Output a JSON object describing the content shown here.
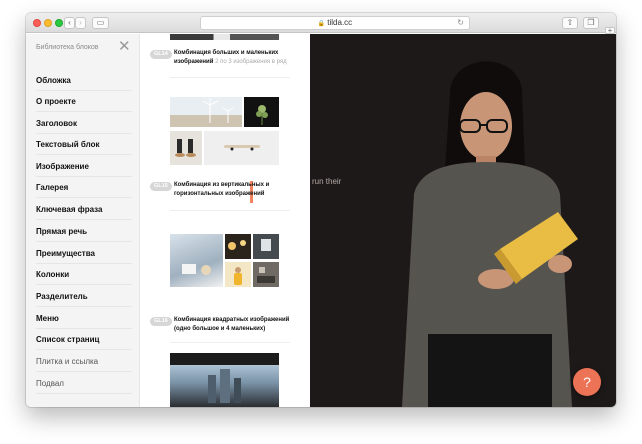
{
  "browser": {
    "url": "tilda.cc"
  },
  "sidebar": {
    "title": "Библиотека блоков",
    "items": [
      {
        "label": "Обложка"
      },
      {
        "label": "О проекте"
      },
      {
        "label": "Заголовок"
      },
      {
        "label": "Текстовый блок"
      },
      {
        "label": "Изображение"
      },
      {
        "label": "Галерея"
      },
      {
        "label": "Ключевая фраза"
      },
      {
        "label": "Прямая речь"
      },
      {
        "label": "Преимущества"
      },
      {
        "label": "Колонки"
      },
      {
        "label": "Разделитель"
      },
      {
        "label": "Меню"
      },
      {
        "label": "Список страниц"
      },
      {
        "label": "Плитка и ссылка"
      },
      {
        "label": "Подвал"
      }
    ]
  },
  "blocks": [
    {
      "code": "GL14",
      "title": "Комбинация больших и маленьких изображений",
      "subtitle": "2 по 3 изображения в ряд"
    },
    {
      "code": "GL15",
      "title": "Комбинация из вертикальных и горизонтальных изображений",
      "subtitle": ""
    },
    {
      "code": "GL16",
      "title": "Комбинация квадратных изображений (одно большое и 4 маленьких)",
      "subtitle": ""
    }
  ],
  "hero": {
    "text_fragment": "run their"
  },
  "help": {
    "label": "?"
  },
  "colors": {
    "accent": "#f4845f",
    "help_button": "#ec7356",
    "hero_bg": "#1e1919"
  }
}
